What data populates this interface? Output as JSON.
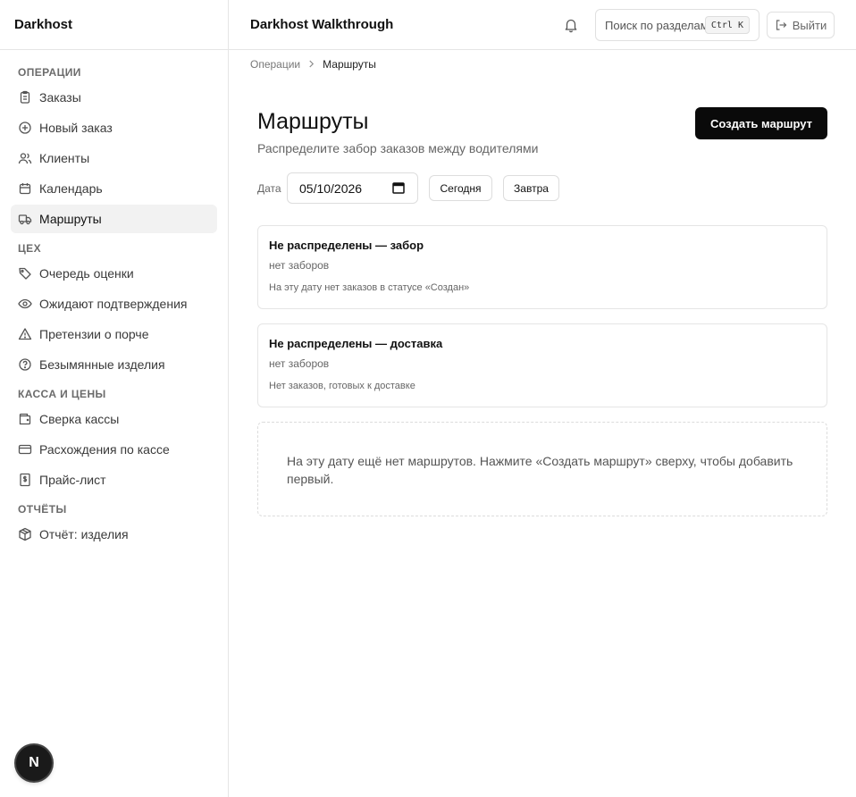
{
  "app": {
    "brand": "Darkhost",
    "header_title": "Darkhost Walkthrough"
  },
  "sidebar": {
    "sections": [
      {
        "title": "ОПЕРАЦИИ",
        "items": [
          {
            "label": "Заказы",
            "icon": "clipboard-icon"
          },
          {
            "label": "Новый заказ",
            "icon": "plus-circle-icon"
          },
          {
            "label": "Клиенты",
            "icon": "users-icon"
          },
          {
            "label": "Календарь",
            "icon": "calendar-icon"
          },
          {
            "label": "Маршруты",
            "icon": "truck-icon",
            "active": true
          }
        ]
      },
      {
        "title": "ЦЕХ",
        "items": [
          {
            "label": "Очередь оценки",
            "icon": "tag-icon"
          },
          {
            "label": "Ожидают подтверждения",
            "icon": "eye-icon"
          },
          {
            "label": "Претензии о порче",
            "icon": "warning-icon"
          },
          {
            "label": "Безымянные изделия",
            "icon": "question-circle-icon"
          }
        ]
      },
      {
        "title": "КАССА И ЦЕНЫ",
        "items": [
          {
            "label": "Сверка кассы",
            "icon": "wallet-icon"
          },
          {
            "label": "Расхождения по кассе",
            "icon": "credit-card-icon"
          },
          {
            "label": "Прайс-лист",
            "icon": "dollar-receipt-icon"
          }
        ]
      },
      {
        "title": "ОТЧЁТЫ",
        "items": [
          {
            "label": "Отчёт: изделия",
            "icon": "package-icon"
          }
        ]
      }
    ],
    "badge": "N"
  },
  "header": {
    "search_placeholder": "Поиск по разделам",
    "search_shortcut": "Ctrl K",
    "logout_label": "Выйти"
  },
  "breadcrumb": {
    "parent": "Операции",
    "current": "Маршруты"
  },
  "page": {
    "title": "Маршруты",
    "subtitle": "Распределите забор заказов между водителями",
    "create_button": "Создать маршрут",
    "date_label": "Дата",
    "date_value": "05/10/2026",
    "today_button": "Сегодня",
    "tomorrow_button": "Завтра"
  },
  "cards": [
    {
      "title": "Не распределены — забор",
      "subtitle": "нет заборов",
      "note": "На эту дату нет заказов в статусе «Создан»"
    },
    {
      "title": "Не распределены — доставка",
      "subtitle": "нет заборов",
      "note": "Нет заказов, готовых к доставке"
    }
  ],
  "empty_state": "На эту дату ещё нет маршрутов. Нажмите «Создать маршрут» сверху, чтобы добавить первый."
}
